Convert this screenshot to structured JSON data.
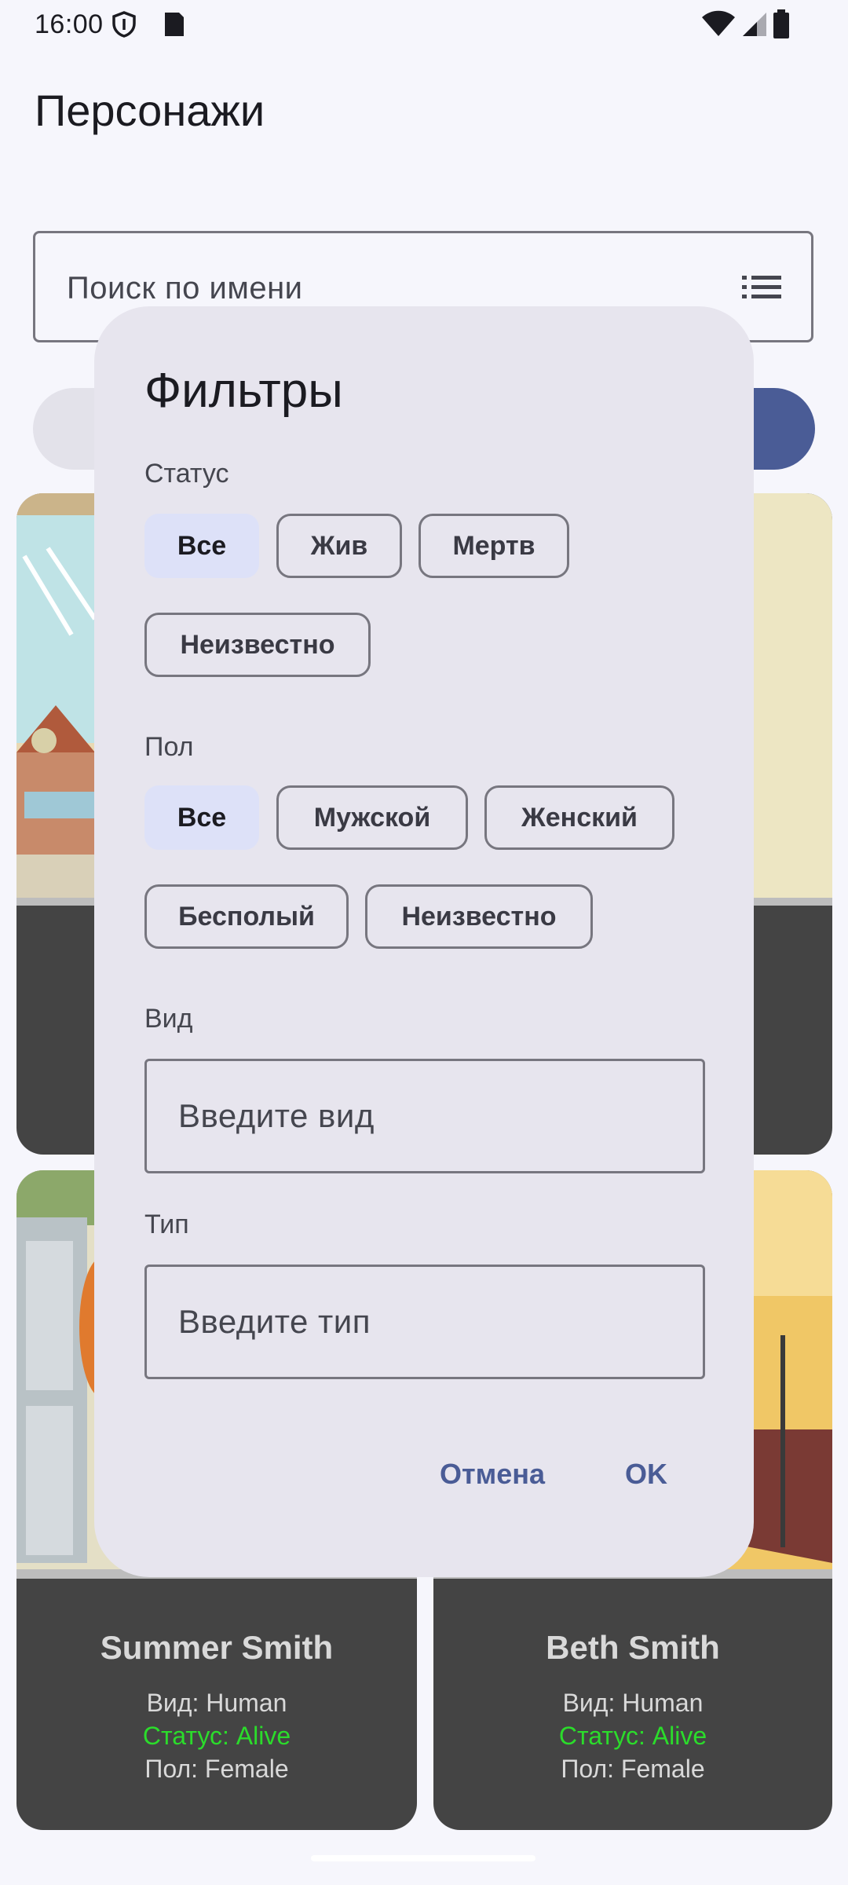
{
  "status_bar": {
    "time": "16:00"
  },
  "app_title": "Персонажи",
  "search": {
    "placeholder": "Поиск по имени"
  },
  "cards": [
    {
      "name": "Summer Smith",
      "species": "Вид: Human",
      "status": "Статус: Alive",
      "gender": "Пол: Female"
    },
    {
      "name": "Beth Smith",
      "species": "Вид: Human",
      "status": "Статус: Alive",
      "gender": "Пол: Female"
    }
  ],
  "dialog": {
    "title": "Фильтры",
    "status_label": "Статус",
    "status_options": [
      "Все",
      "Жив",
      "Мертв",
      "Неизвестно"
    ],
    "status_selected": "Все",
    "gender_label": "Пол",
    "gender_options": [
      "Все",
      "Мужской",
      "Женский",
      "Бесполый",
      "Неизвестно"
    ],
    "gender_selected": "Все",
    "species_label": "Вид",
    "species_placeholder": "Введите вид",
    "type_label": "Тип",
    "type_placeholder": "Введите тип",
    "cancel_label": "Отмена",
    "ok_label": "OK"
  },
  "colors": {
    "background": "#f6f6fc",
    "dialog_bg": "#e7e5ee",
    "selected_chip": "#dde1f8",
    "accent": "#4a5c96",
    "card_bg": "#444444",
    "alive_text": "#2bdc2b"
  },
  "icons": [
    "shield-icon",
    "sim-card-icon",
    "wifi-icon",
    "signal-icon",
    "battery-icon",
    "list-icon"
  ]
}
